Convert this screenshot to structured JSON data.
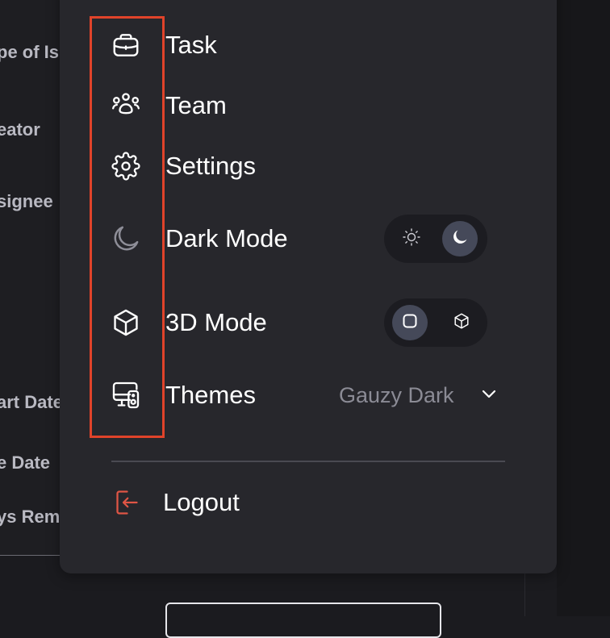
{
  "background": {
    "labels": [
      "pe of Is",
      "eator",
      "signee",
      "art Date",
      "e Date",
      "ys Rem"
    ]
  },
  "menu": {
    "items": [
      {
        "label": "Task",
        "icon": "briefcase-icon"
      },
      {
        "label": "Team",
        "icon": "team-icon"
      },
      {
        "label": "Settings",
        "icon": "gear-icon"
      },
      {
        "label": "Dark Mode",
        "icon": "moon-icon"
      },
      {
        "label": "3D Mode",
        "icon": "cube-icon"
      },
      {
        "label": "Themes",
        "icon": "devices-icon"
      }
    ],
    "dark_mode_toggle": {
      "options": [
        "sun-icon",
        "moon-icon"
      ],
      "selected": "moon-icon"
    },
    "mode_3d_toggle": {
      "options": [
        "square-icon",
        "cube-icon"
      ],
      "selected": "square-icon"
    },
    "themes_value": "Gauzy Dark",
    "logout_label": "Logout"
  },
  "colors": {
    "panel": "#27272c",
    "highlight": "#e0432a",
    "logout_icon": "#e05545",
    "toggle_active": "#454959"
  }
}
